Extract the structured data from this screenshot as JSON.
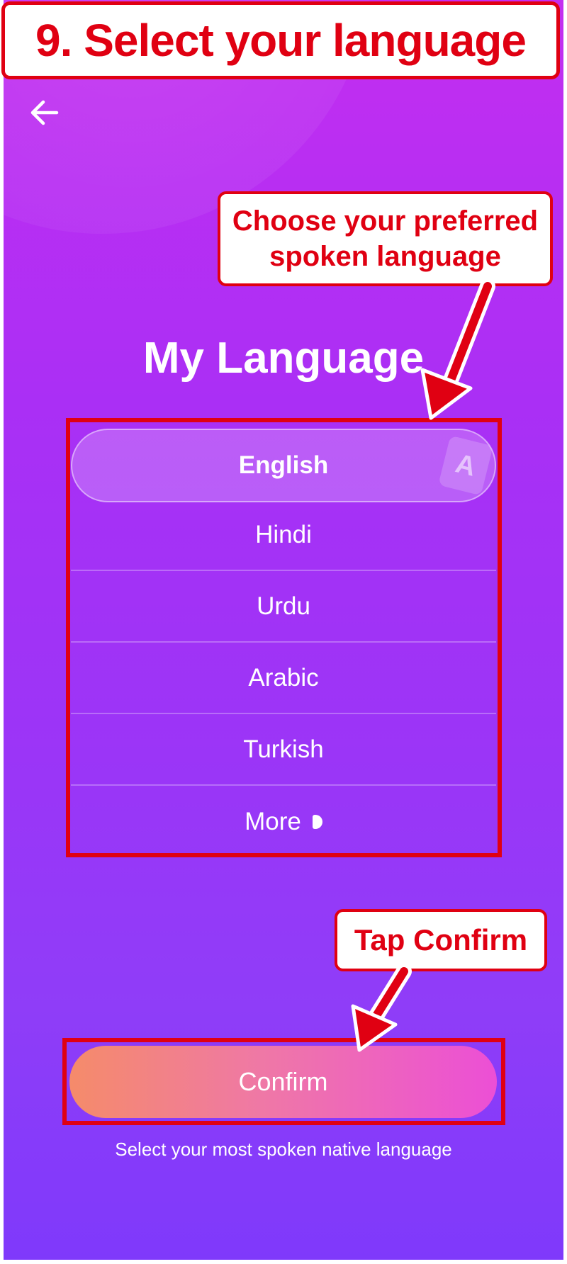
{
  "tutorial": {
    "step_title": "9. Select your language",
    "callout_language_line1": "Choose your preferred",
    "callout_language_line2": "spoken language",
    "callout_confirm": "Tap Confirm"
  },
  "screen": {
    "back_icon": "arrow-left-icon",
    "title": "My Language",
    "languages": [
      {
        "label": "English",
        "selected": true
      },
      {
        "label": "Hindi",
        "selected": false
      },
      {
        "label": "Urdu",
        "selected": false
      },
      {
        "label": "Arabic",
        "selected": false
      },
      {
        "label": "Turkish",
        "selected": false
      }
    ],
    "more_label": "More",
    "selected_badge_letter": "A",
    "confirm_label": "Confirm",
    "hint": "Select your most spoken native language"
  },
  "colors": {
    "annotation_red": "#e00012",
    "background_top": "#c42ef0",
    "background_bottom": "#7f39fb",
    "confirm_gradient_start": "#f58b6a",
    "confirm_gradient_end": "#ec4fd6"
  }
}
